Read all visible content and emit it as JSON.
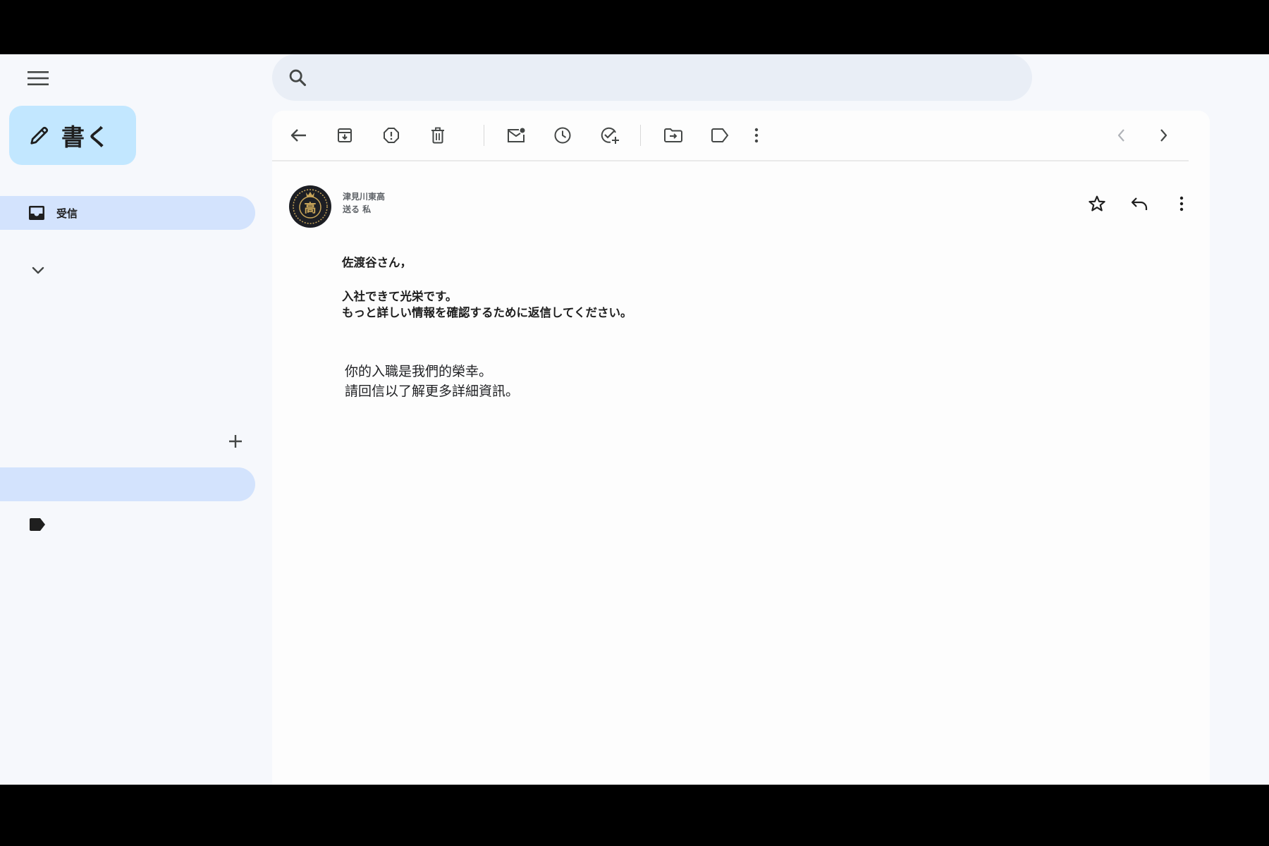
{
  "search": {
    "value": "",
    "placeholder": ""
  },
  "sidebar": {
    "compose_label": "書く",
    "items": [
      {
        "label": "受信",
        "icon": "inbox-icon",
        "selected": true
      }
    ]
  },
  "toolbar": {
    "icons": [
      "back-arrow-icon",
      "archive-icon",
      "report-spam-icon",
      "delete-icon",
      "mark-unread-icon",
      "snooze-icon",
      "add-to-tasks-icon",
      "move-to-icon",
      "label-icon",
      "more-vert-icon",
      "newer-icon",
      "older-icon"
    ]
  },
  "message": {
    "sender_name": "津見川東高",
    "recipient_line": "送る 私",
    "avatar_glyph": "高",
    "body_jp": [
      "佐渡谷さん，",
      "入社できて光栄です。",
      "もっと詳しい情報を確認するために返信してください。"
    ],
    "body_zh": [
      "你的入職是我們的榮幸。",
      "請回信以了解更多詳細資訊。"
    ]
  },
  "colors": {
    "background": "#f6f8fc",
    "compose_bg": "#c2e7ff",
    "selected_nav": "#d3e3fd",
    "search_bg": "#e9eef6"
  }
}
